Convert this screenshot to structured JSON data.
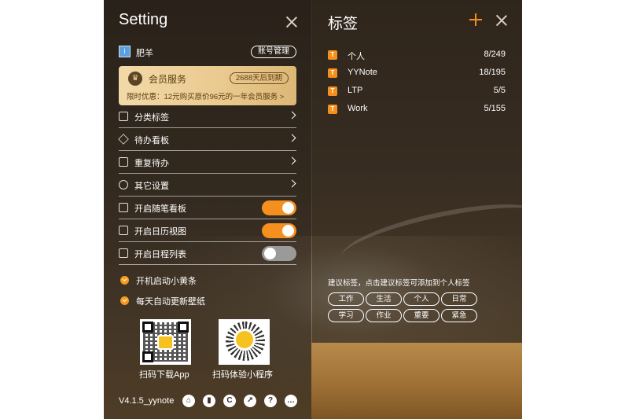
{
  "settings": {
    "title": "Setting",
    "user": {
      "avatar_glyph": "i",
      "name": "肥羊",
      "account_button": "账号管理"
    },
    "vip": {
      "title": "会员服务",
      "expiry_badge": "2688天后到期",
      "promo": "限时优惠：12元购买原价96元的一年会员服务 >"
    },
    "menu": [
      {
        "label": "分类标签",
        "icon": "list-icon"
      },
      {
        "label": "待办看板",
        "icon": "layers-icon"
      },
      {
        "label": "重复待办",
        "icon": "repeat-doc-icon"
      },
      {
        "label": "其它设置",
        "icon": "gear-icon"
      }
    ],
    "toggles": [
      {
        "label": "开启随笔看板",
        "icon": "edit-icon",
        "on": true
      },
      {
        "label": "开启日历视图",
        "icon": "calendar-icon",
        "on": true
      },
      {
        "label": "开启日程列表",
        "icon": "schedule-icon",
        "on": false
      }
    ],
    "checks": [
      {
        "label": "开机启动小黄条",
        "checked": true
      },
      {
        "label": "每天自动更新壁纸",
        "checked": true
      }
    ],
    "qr": {
      "app_caption": "扫码下载App",
      "miniprogram_caption": "扫码体验小程序"
    },
    "version": "V4.1.5_yynote",
    "footer_icons": [
      "home-icon",
      "book-icon",
      "copyright-icon",
      "share-icon",
      "help-icon",
      "more-icon"
    ],
    "footer_glyphs": [
      "⌂",
      "▮",
      "C",
      "↗",
      "?",
      "…"
    ]
  },
  "tags": {
    "title": "标签",
    "items": [
      {
        "badge": "T",
        "name": "个人",
        "count": "8/249"
      },
      {
        "badge": "T",
        "name": "YYNote",
        "count": "18/195"
      },
      {
        "badge": "T",
        "name": "LTP",
        "count": "5/5"
      },
      {
        "badge": "T",
        "name": "Work",
        "count": "5/155"
      }
    ],
    "suggest_hint": "建议标签，点击建议标签可添加到个人标签",
    "suggested": [
      "工作",
      "生活",
      "个人",
      "日常",
      "学习",
      "作业",
      "重要",
      "紧急"
    ]
  },
  "colors": {
    "accent": "#f5901f",
    "toggle_off": "#9a9a9a",
    "vip_gold": "#e9c98e"
  }
}
